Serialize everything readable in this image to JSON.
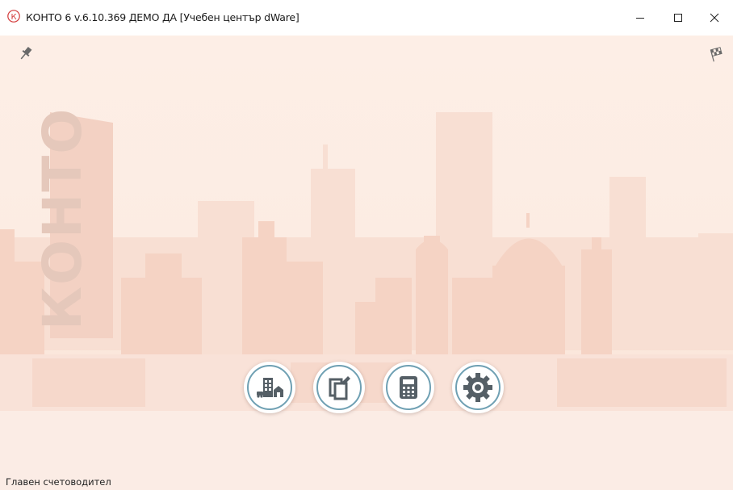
{
  "window": {
    "title": "КОНТО 6 v.6.10.369 ДЕМО ДА [Учебен център dWare]",
    "app_icon": "konto-k-logo",
    "controls": [
      "minimize-icon",
      "maximize-icon",
      "close-icon"
    ]
  },
  "background": {
    "brand_text": "КОНТО",
    "colors": {
      "background": "#fdeee6",
      "buildings": "#f6d6c8",
      "brand_text": "#e6c9bd"
    }
  },
  "toolbar": {
    "pin_icon": "pin-icon",
    "flag_icon": "checkered-flag-icon"
  },
  "main_buttons": [
    {
      "icon": "buildings-icon"
    },
    {
      "icon": "documents-edit-icon"
    },
    {
      "icon": "calculator-icon"
    },
    {
      "icon": "gear-icon"
    }
  ],
  "colors": {
    "button_ring": "#6fa0b3",
    "icon_fill": "#555f66"
  },
  "status": {
    "user_role": "Главен счетоводител"
  }
}
